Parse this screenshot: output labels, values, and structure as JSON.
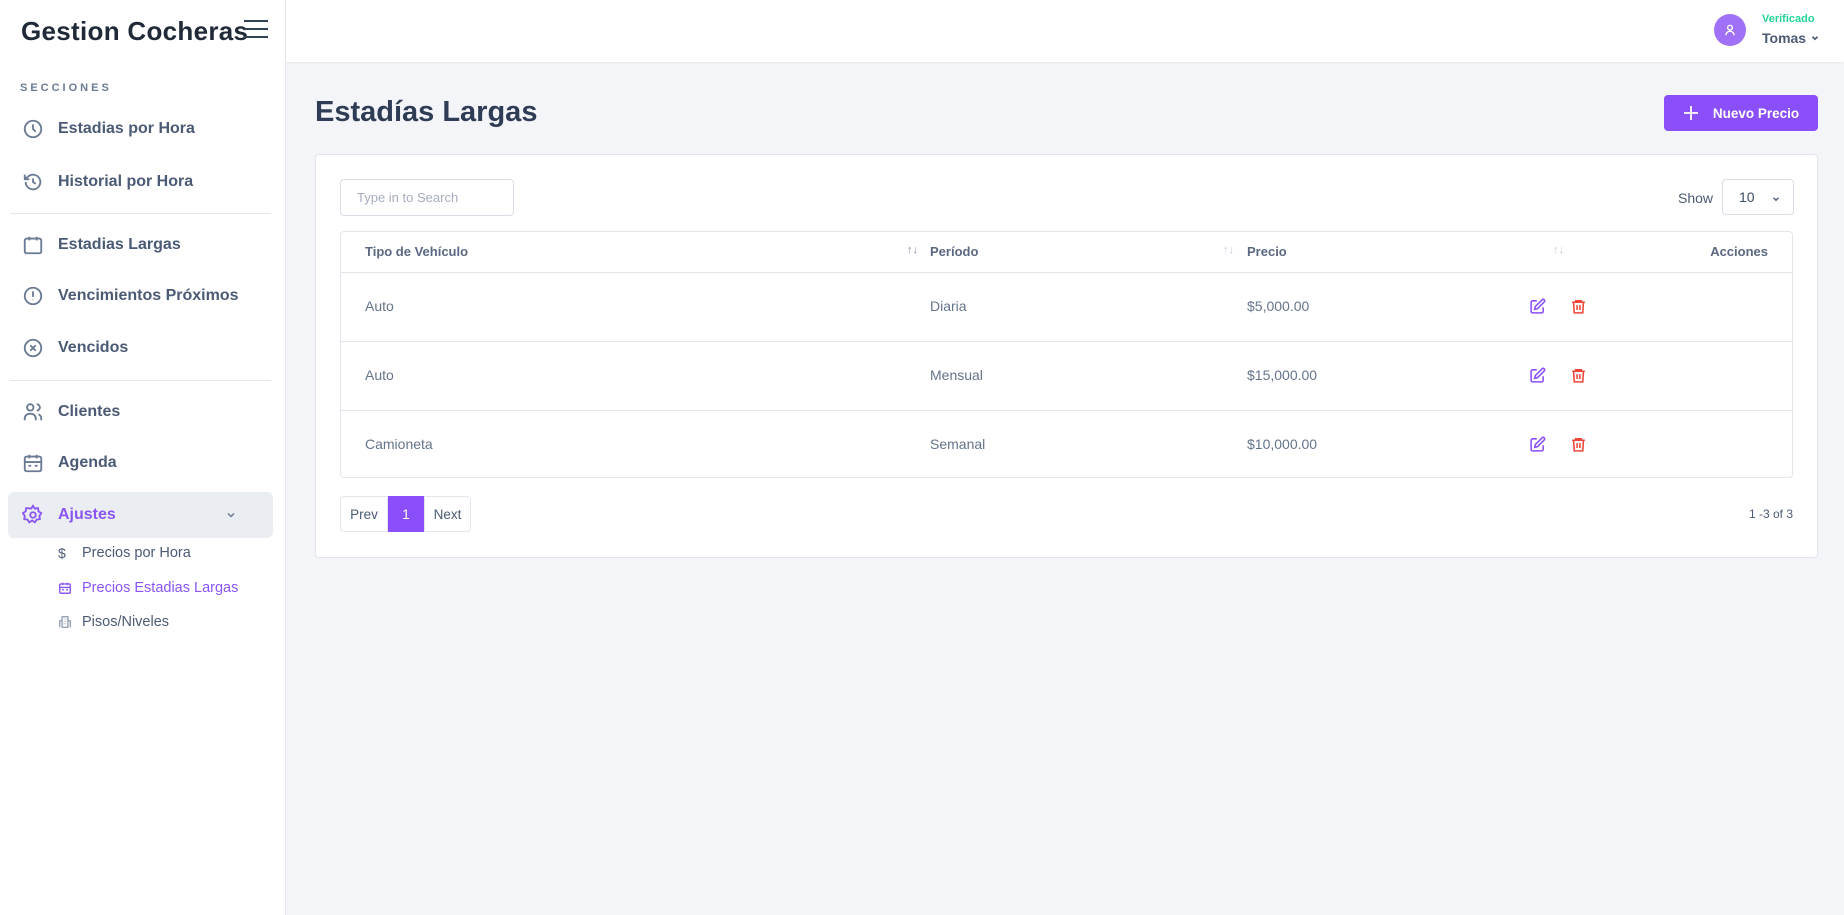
{
  "sidebar": {
    "brand": "Gestion Cocheras",
    "section_label": "SECCIONES",
    "items": [
      {
        "label": "Estadias por Hora",
        "icon": "clock-icon"
      },
      {
        "label": "Historial por Hora",
        "icon": "history-icon"
      },
      {
        "label": "Estadias Largas",
        "icon": "calendar-icon"
      },
      {
        "label": "Vencimientos Próximos",
        "icon": "alert-circle-icon"
      },
      {
        "label": "Vencidos",
        "icon": "x-circle-icon"
      },
      {
        "label": "Clientes",
        "icon": "users-icon"
      },
      {
        "label": "Agenda",
        "icon": "calendar-icon"
      },
      {
        "label": "Ajustes",
        "icon": "gear-icon",
        "active": true
      }
    ],
    "subitems": [
      {
        "label": "Precios por Hora",
        "icon": "dollar-icon"
      },
      {
        "label": "Precios Estadias Largas",
        "icon": "calendar-icon",
        "active": true
      },
      {
        "label": "Pisos/Niveles",
        "icon": "building-icon"
      }
    ]
  },
  "header": {
    "status": "Verificado",
    "user": "Tomas"
  },
  "main": {
    "title": "Estadías Largas",
    "new_button": "Nuevo Precio",
    "search_placeholder": "Type in to Search",
    "show_label": "Show",
    "show_value": "10",
    "columns": [
      "Tipo de Vehículo",
      "Período",
      "Precio",
      "Acciones"
    ],
    "rows": [
      [
        "Auto",
        "Diaria",
        "$5,000.00"
      ],
      [
        "Auto",
        "Mensual",
        "$15,000.00"
      ],
      [
        "Camioneta",
        "Semanal",
        "$10,000.00"
      ]
    ],
    "pagination": {
      "prev": "Prev",
      "page": "1",
      "next": "Next",
      "info": "1 -3 of 3"
    }
  },
  "colors": {
    "accent": "#8b4ffa",
    "verified": "#22d39a",
    "delete": "#f04438"
  }
}
